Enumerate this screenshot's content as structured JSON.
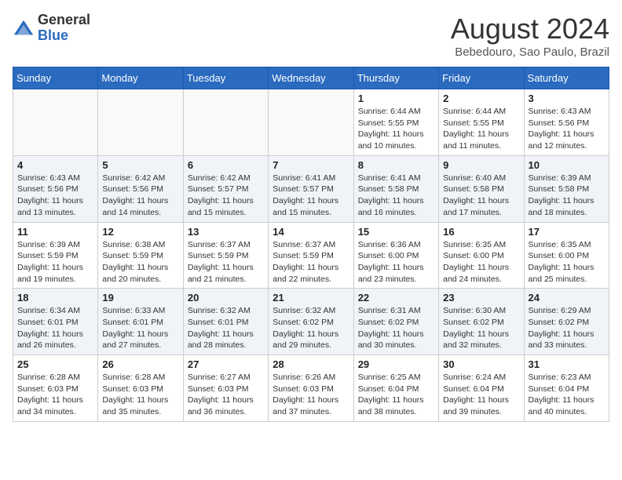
{
  "header": {
    "logo_general": "General",
    "logo_blue": "Blue",
    "month_year": "August 2024",
    "location": "Bebedouro, Sao Paulo, Brazil"
  },
  "days_of_week": [
    "Sunday",
    "Monday",
    "Tuesday",
    "Wednesday",
    "Thursday",
    "Friday",
    "Saturday"
  ],
  "weeks": [
    {
      "stripe": false,
      "days": [
        {
          "num": "",
          "text": ""
        },
        {
          "num": "",
          "text": ""
        },
        {
          "num": "",
          "text": ""
        },
        {
          "num": "",
          "text": ""
        },
        {
          "num": "1",
          "text": "Sunrise: 6:44 AM\nSunset: 5:55 PM\nDaylight: 11 hours\nand 10 minutes."
        },
        {
          "num": "2",
          "text": "Sunrise: 6:44 AM\nSunset: 5:55 PM\nDaylight: 11 hours\nand 11 minutes."
        },
        {
          "num": "3",
          "text": "Sunrise: 6:43 AM\nSunset: 5:56 PM\nDaylight: 11 hours\nand 12 minutes."
        }
      ]
    },
    {
      "stripe": true,
      "days": [
        {
          "num": "4",
          "text": "Sunrise: 6:43 AM\nSunset: 5:56 PM\nDaylight: 11 hours\nand 13 minutes."
        },
        {
          "num": "5",
          "text": "Sunrise: 6:42 AM\nSunset: 5:56 PM\nDaylight: 11 hours\nand 14 minutes."
        },
        {
          "num": "6",
          "text": "Sunrise: 6:42 AM\nSunset: 5:57 PM\nDaylight: 11 hours\nand 15 minutes."
        },
        {
          "num": "7",
          "text": "Sunrise: 6:41 AM\nSunset: 5:57 PM\nDaylight: 11 hours\nand 15 minutes."
        },
        {
          "num": "8",
          "text": "Sunrise: 6:41 AM\nSunset: 5:58 PM\nDaylight: 11 hours\nand 16 minutes."
        },
        {
          "num": "9",
          "text": "Sunrise: 6:40 AM\nSunset: 5:58 PM\nDaylight: 11 hours\nand 17 minutes."
        },
        {
          "num": "10",
          "text": "Sunrise: 6:39 AM\nSunset: 5:58 PM\nDaylight: 11 hours\nand 18 minutes."
        }
      ]
    },
    {
      "stripe": false,
      "days": [
        {
          "num": "11",
          "text": "Sunrise: 6:39 AM\nSunset: 5:59 PM\nDaylight: 11 hours\nand 19 minutes."
        },
        {
          "num": "12",
          "text": "Sunrise: 6:38 AM\nSunset: 5:59 PM\nDaylight: 11 hours\nand 20 minutes."
        },
        {
          "num": "13",
          "text": "Sunrise: 6:37 AM\nSunset: 5:59 PM\nDaylight: 11 hours\nand 21 minutes."
        },
        {
          "num": "14",
          "text": "Sunrise: 6:37 AM\nSunset: 5:59 PM\nDaylight: 11 hours\nand 22 minutes."
        },
        {
          "num": "15",
          "text": "Sunrise: 6:36 AM\nSunset: 6:00 PM\nDaylight: 11 hours\nand 23 minutes."
        },
        {
          "num": "16",
          "text": "Sunrise: 6:35 AM\nSunset: 6:00 PM\nDaylight: 11 hours\nand 24 minutes."
        },
        {
          "num": "17",
          "text": "Sunrise: 6:35 AM\nSunset: 6:00 PM\nDaylight: 11 hours\nand 25 minutes."
        }
      ]
    },
    {
      "stripe": true,
      "days": [
        {
          "num": "18",
          "text": "Sunrise: 6:34 AM\nSunset: 6:01 PM\nDaylight: 11 hours\nand 26 minutes."
        },
        {
          "num": "19",
          "text": "Sunrise: 6:33 AM\nSunset: 6:01 PM\nDaylight: 11 hours\nand 27 minutes."
        },
        {
          "num": "20",
          "text": "Sunrise: 6:32 AM\nSunset: 6:01 PM\nDaylight: 11 hours\nand 28 minutes."
        },
        {
          "num": "21",
          "text": "Sunrise: 6:32 AM\nSunset: 6:02 PM\nDaylight: 11 hours\nand 29 minutes."
        },
        {
          "num": "22",
          "text": "Sunrise: 6:31 AM\nSunset: 6:02 PM\nDaylight: 11 hours\nand 30 minutes."
        },
        {
          "num": "23",
          "text": "Sunrise: 6:30 AM\nSunset: 6:02 PM\nDaylight: 11 hours\nand 32 minutes."
        },
        {
          "num": "24",
          "text": "Sunrise: 6:29 AM\nSunset: 6:02 PM\nDaylight: 11 hours\nand 33 minutes."
        }
      ]
    },
    {
      "stripe": false,
      "days": [
        {
          "num": "25",
          "text": "Sunrise: 6:28 AM\nSunset: 6:03 PM\nDaylight: 11 hours\nand 34 minutes."
        },
        {
          "num": "26",
          "text": "Sunrise: 6:28 AM\nSunset: 6:03 PM\nDaylight: 11 hours\nand 35 minutes."
        },
        {
          "num": "27",
          "text": "Sunrise: 6:27 AM\nSunset: 6:03 PM\nDaylight: 11 hours\nand 36 minutes."
        },
        {
          "num": "28",
          "text": "Sunrise: 6:26 AM\nSunset: 6:03 PM\nDaylight: 11 hours\nand 37 minutes."
        },
        {
          "num": "29",
          "text": "Sunrise: 6:25 AM\nSunset: 6:04 PM\nDaylight: 11 hours\nand 38 minutes."
        },
        {
          "num": "30",
          "text": "Sunrise: 6:24 AM\nSunset: 6:04 PM\nDaylight: 11 hours\nand 39 minutes."
        },
        {
          "num": "31",
          "text": "Sunrise: 6:23 AM\nSunset: 6:04 PM\nDaylight: 11 hours\nand 40 minutes."
        }
      ]
    }
  ]
}
